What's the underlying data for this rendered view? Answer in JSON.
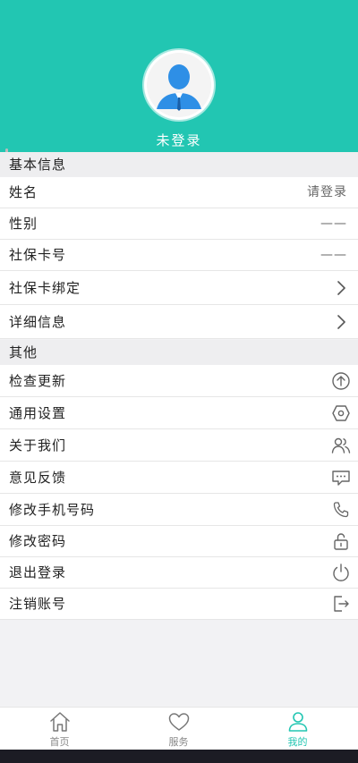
{
  "header": {
    "login_status": "未登录",
    "bg_color": "#22c6b2",
    "avatar_icon": "user-avatar-icon"
  },
  "sections": {
    "basic_title": "基本信息",
    "other_title": "其他"
  },
  "basic_info": [
    {
      "label": "姓名",
      "value": "请登录"
    },
    {
      "label": "性别",
      "value": "——"
    },
    {
      "label": "社保卡号",
      "value": "——"
    },
    {
      "label": "社保卡绑定",
      "icon": "chevron-right-icon"
    },
    {
      "label": "详细信息",
      "icon": "chevron-right-icon"
    }
  ],
  "other": [
    {
      "label": "检查更新",
      "icon": "upload-circle-icon"
    },
    {
      "label": "通用设置",
      "icon": "settings-hexagon-icon"
    },
    {
      "label": "关于我们",
      "icon": "users-icon"
    },
    {
      "label": "意见反馈",
      "icon": "message-icon"
    },
    {
      "label": "修改手机号码",
      "icon": "phone-icon"
    },
    {
      "label": "修改密码",
      "icon": "unlock-icon"
    },
    {
      "label": "退出登录",
      "icon": "power-icon"
    },
    {
      "label": "注销账号",
      "icon": "logout-icon"
    }
  ],
  "nav": [
    {
      "label": "首页",
      "icon": "home-icon"
    },
    {
      "label": "服务",
      "icon": "heart-icon"
    },
    {
      "label": "我的",
      "icon": "user-icon",
      "active": true
    }
  ]
}
